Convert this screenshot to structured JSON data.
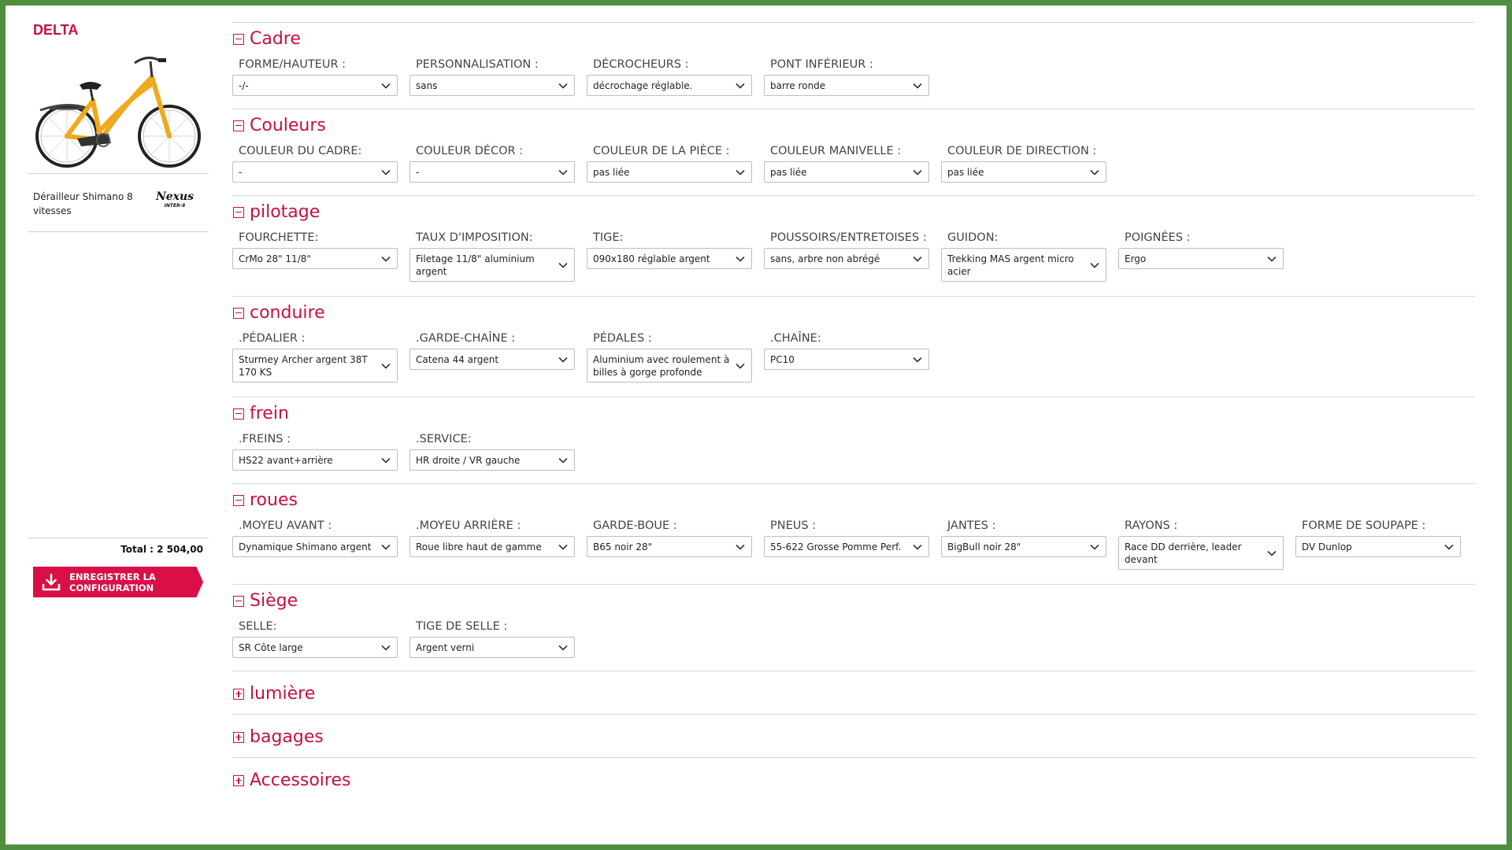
{
  "sidebar": {
    "model_name": "DELTA",
    "derailleur_text": "Dérailleur Shimano 8 vitesses",
    "logo": {
      "line1": "Nexus",
      "line2": "INTER-8"
    },
    "total_text": "Total : 2 504,00",
    "save_label": "ENREGISTRER LA CONFIGURATION"
  },
  "colors": {
    "accent": "#c8103e",
    "button": "#d90f45",
    "frame_border": "#4f8d3f",
    "bike": "#f0a81c"
  },
  "sections": [
    {
      "title": "Cadre",
      "expanded": true,
      "fields": [
        {
          "label": "FORME/HAUTEUR :",
          "value": "-/-"
        },
        {
          "label": "PERSONNALISATION :",
          "value": "sans"
        },
        {
          "label": "DÉCROCHEURS :",
          "value": "décrochage réglable."
        },
        {
          "label": "PONT INFÉRIEUR :",
          "value": "barre ronde"
        }
      ]
    },
    {
      "title": "Couleurs",
      "expanded": true,
      "fields": [
        {
          "label": "COULEUR DU CADRE:",
          "value": "-"
        },
        {
          "label": "COULEUR DÉCOR :",
          "value": "-"
        },
        {
          "label": "COULEUR DE LA PIÈCE :",
          "value": "pas liée"
        },
        {
          "label": "COULEUR MANIVELLE :",
          "value": "pas liée"
        },
        {
          "label": "COULEUR DE DIRECTION :",
          "value": "pas liée"
        }
      ]
    },
    {
      "title": "pilotage",
      "expanded": true,
      "fields": [
        {
          "label": "FOURCHETTE:",
          "value": "CrMo 28\" 11/8\""
        },
        {
          "label": "TAUX D'IMPOSITION:",
          "value": "Filetage 11/8\" aluminium argent"
        },
        {
          "label": "TIGE:",
          "value": "090x180 réglable argent"
        },
        {
          "label": "POUSSOIRS/ENTRETOISES :",
          "value": "sans, arbre non abrégé"
        },
        {
          "label": "GUIDON:",
          "value": "Trekking MAS argent micro acier"
        },
        {
          "label": "POIGNÉES :",
          "value": "Ergo"
        }
      ]
    },
    {
      "title": "conduire",
      "expanded": true,
      "fields": [
        {
          "label": ".PÉDALIER :",
          "value": "Sturmey Archer argent 38T 170 KS"
        },
        {
          "label": ".GARDE-CHAÎNE :",
          "value": "Catena 44 argent"
        },
        {
          "label": "PÉDALES :",
          "value": "Aluminium avec roulement à billes à gorge profonde"
        },
        {
          "label": ".CHAÎNE:",
          "value": "PC10"
        }
      ]
    },
    {
      "title": "frein",
      "expanded": true,
      "fields": [
        {
          "label": ".FREINS :",
          "value": "HS22 avant+arrière"
        },
        {
          "label": ".SERVICE:",
          "value": "HR droite / VR gauche"
        }
      ]
    },
    {
      "title": "roues",
      "expanded": true,
      "fields": [
        {
          "label": ".MOYEU AVANT :",
          "value": "Dynamique Shimano argent"
        },
        {
          "label": ".MOYEU ARRIÈRE :",
          "value": "Roue libre haut de gamme"
        },
        {
          "label": "GARDE-BOUE :",
          "value": "B65 noir 28\""
        },
        {
          "label": "PNEUS :",
          "value": "55-622 Grosse Pomme Perf."
        },
        {
          "label": "JANTES :",
          "value": "BigBull noir 28\""
        },
        {
          "label": "RAYONS :",
          "value": "Race DD derrière, leader devant"
        },
        {
          "label": "FORME DE SOUPAPE :",
          "value": "DV Dunlop"
        }
      ]
    },
    {
      "title": "Siège",
      "expanded": true,
      "fields": [
        {
          "label": "SELLE:",
          "value": "SR Côte large"
        },
        {
          "label": "TIGE DE SELLE :",
          "value": "Argent verni"
        }
      ]
    },
    {
      "title": "lumière",
      "expanded": false,
      "fields": []
    },
    {
      "title": "bagages",
      "expanded": false,
      "fields": []
    },
    {
      "title": "Accessoires",
      "expanded": false,
      "fields": []
    }
  ]
}
